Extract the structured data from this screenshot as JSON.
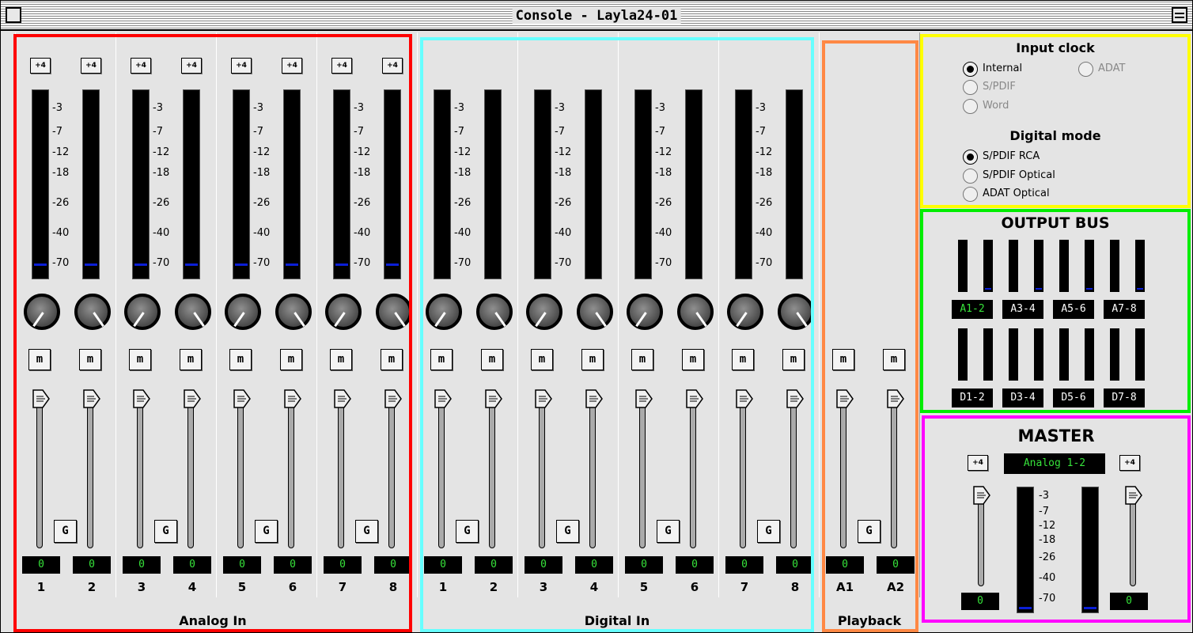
{
  "window": {
    "title": "Console - Layla24-01"
  },
  "groups": {
    "analog": "Analog In",
    "digital": "Digital In",
    "playback": "Playback"
  },
  "scale": [
    "-3",
    "-7",
    "-12",
    "-18",
    "-26",
    "-40",
    "-70"
  ],
  "trim_label": "+4",
  "mute_label": "m",
  "gang_label": "G",
  "channels": [
    {
      "num": "1",
      "value": "0"
    },
    {
      "num": "2",
      "value": "0"
    },
    {
      "num": "3",
      "value": "0"
    },
    {
      "num": "4",
      "value": "0"
    },
    {
      "num": "5",
      "value": "0"
    },
    {
      "num": "6",
      "value": "0"
    },
    {
      "num": "7",
      "value": "0"
    },
    {
      "num": "8",
      "value": "0"
    },
    {
      "num": "1",
      "value": "0"
    },
    {
      "num": "2",
      "value": "0"
    },
    {
      "num": "3",
      "value": "0"
    },
    {
      "num": "4",
      "value": "0"
    },
    {
      "num": "5",
      "value": "0"
    },
    {
      "num": "6",
      "value": "0"
    },
    {
      "num": "7",
      "value": "0"
    },
    {
      "num": "8",
      "value": "0"
    },
    {
      "num": "A1",
      "value": "0"
    },
    {
      "num": "A2",
      "value": "0"
    }
  ],
  "input_clock": {
    "title": "Input clock",
    "options": [
      "Internal",
      "ADAT",
      "S/PDIF",
      "Word"
    ],
    "selected": "Internal"
  },
  "digital_mode": {
    "title": "Digital mode",
    "options": [
      "S/PDIF RCA",
      "S/PDIF Optical",
      "ADAT Optical"
    ],
    "selected": "S/PDIF RCA"
  },
  "output_bus": {
    "title": "OUTPUT BUS",
    "analog": [
      "A1-2",
      "A3-4",
      "A5-6",
      "A7-8"
    ],
    "digital": [
      "D1-2",
      "D3-4",
      "D5-6",
      "D7-8"
    ],
    "selected": "A1-2"
  },
  "master": {
    "title": "MASTER",
    "trim": "+4",
    "source": "Analog 1-2",
    "left_value": "0",
    "right_value": "0"
  },
  "colors": {
    "analog_frame": "#ff0000",
    "digital_frame": "#66ffff",
    "playback_frame": "#ff8844",
    "clock_frame": "#ffff00",
    "bus_frame": "#00ee00",
    "master_frame": "#ff00ff",
    "value_text": "#36e33a",
    "meter_level": "#0b1fd6"
  }
}
